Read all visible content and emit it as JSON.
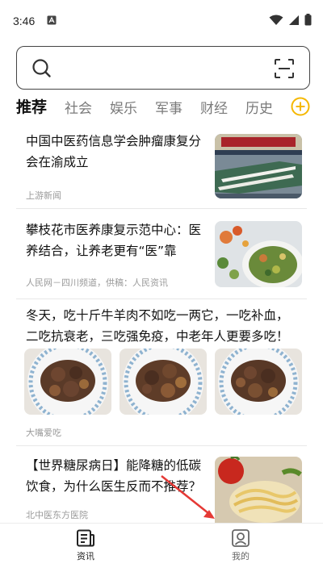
{
  "status_bar": {
    "time": "3:46"
  },
  "search": {
    "placeholder": ""
  },
  "tabs": [
    {
      "label": "推荐",
      "active": true
    },
    {
      "label": "社会",
      "active": false
    },
    {
      "label": "娱乐",
      "active": false
    },
    {
      "label": "军事",
      "active": false
    },
    {
      "label": "财经",
      "active": false
    },
    {
      "label": "历史",
      "active": false
    }
  ],
  "feed": [
    {
      "title": "中国中医药信息学会肿瘤康复分会在渝成立",
      "source": "上游新闻",
      "thumbnail": "conference-hall-photo"
    },
    {
      "title": "攀枝花市医养康复示范中心：医养结合，让养老更有“医”靠",
      "source": "人民网－四川频道，供稿：人民资讯",
      "thumbnail": "salad-plate-photo"
    },
    {
      "title": "冬天，吃十斤牛羊肉不如吃一两它，一吃补血，二吃抗衰老，三吃强免疫，中老年人更要多吃！",
      "source": "大嘴爱吃",
      "thumbnails": [
        "braised-meat-photo",
        "braised-meat-photo",
        "braised-meat-photo"
      ]
    },
    {
      "title": "【世界糖尿病日】能降糖的低碳饮食，为什么医生反而不推荐？",
      "source": "北中医东方医院",
      "thumbnail": "pasta-dish-photo"
    }
  ],
  "bottom_nav": [
    {
      "label": "资讯",
      "icon": "news-icon",
      "active": true
    },
    {
      "label": "我的",
      "icon": "profile-icon",
      "active": false
    }
  ],
  "colors": {
    "accent": "#f5b800",
    "annotation_arrow": "#e53935"
  }
}
